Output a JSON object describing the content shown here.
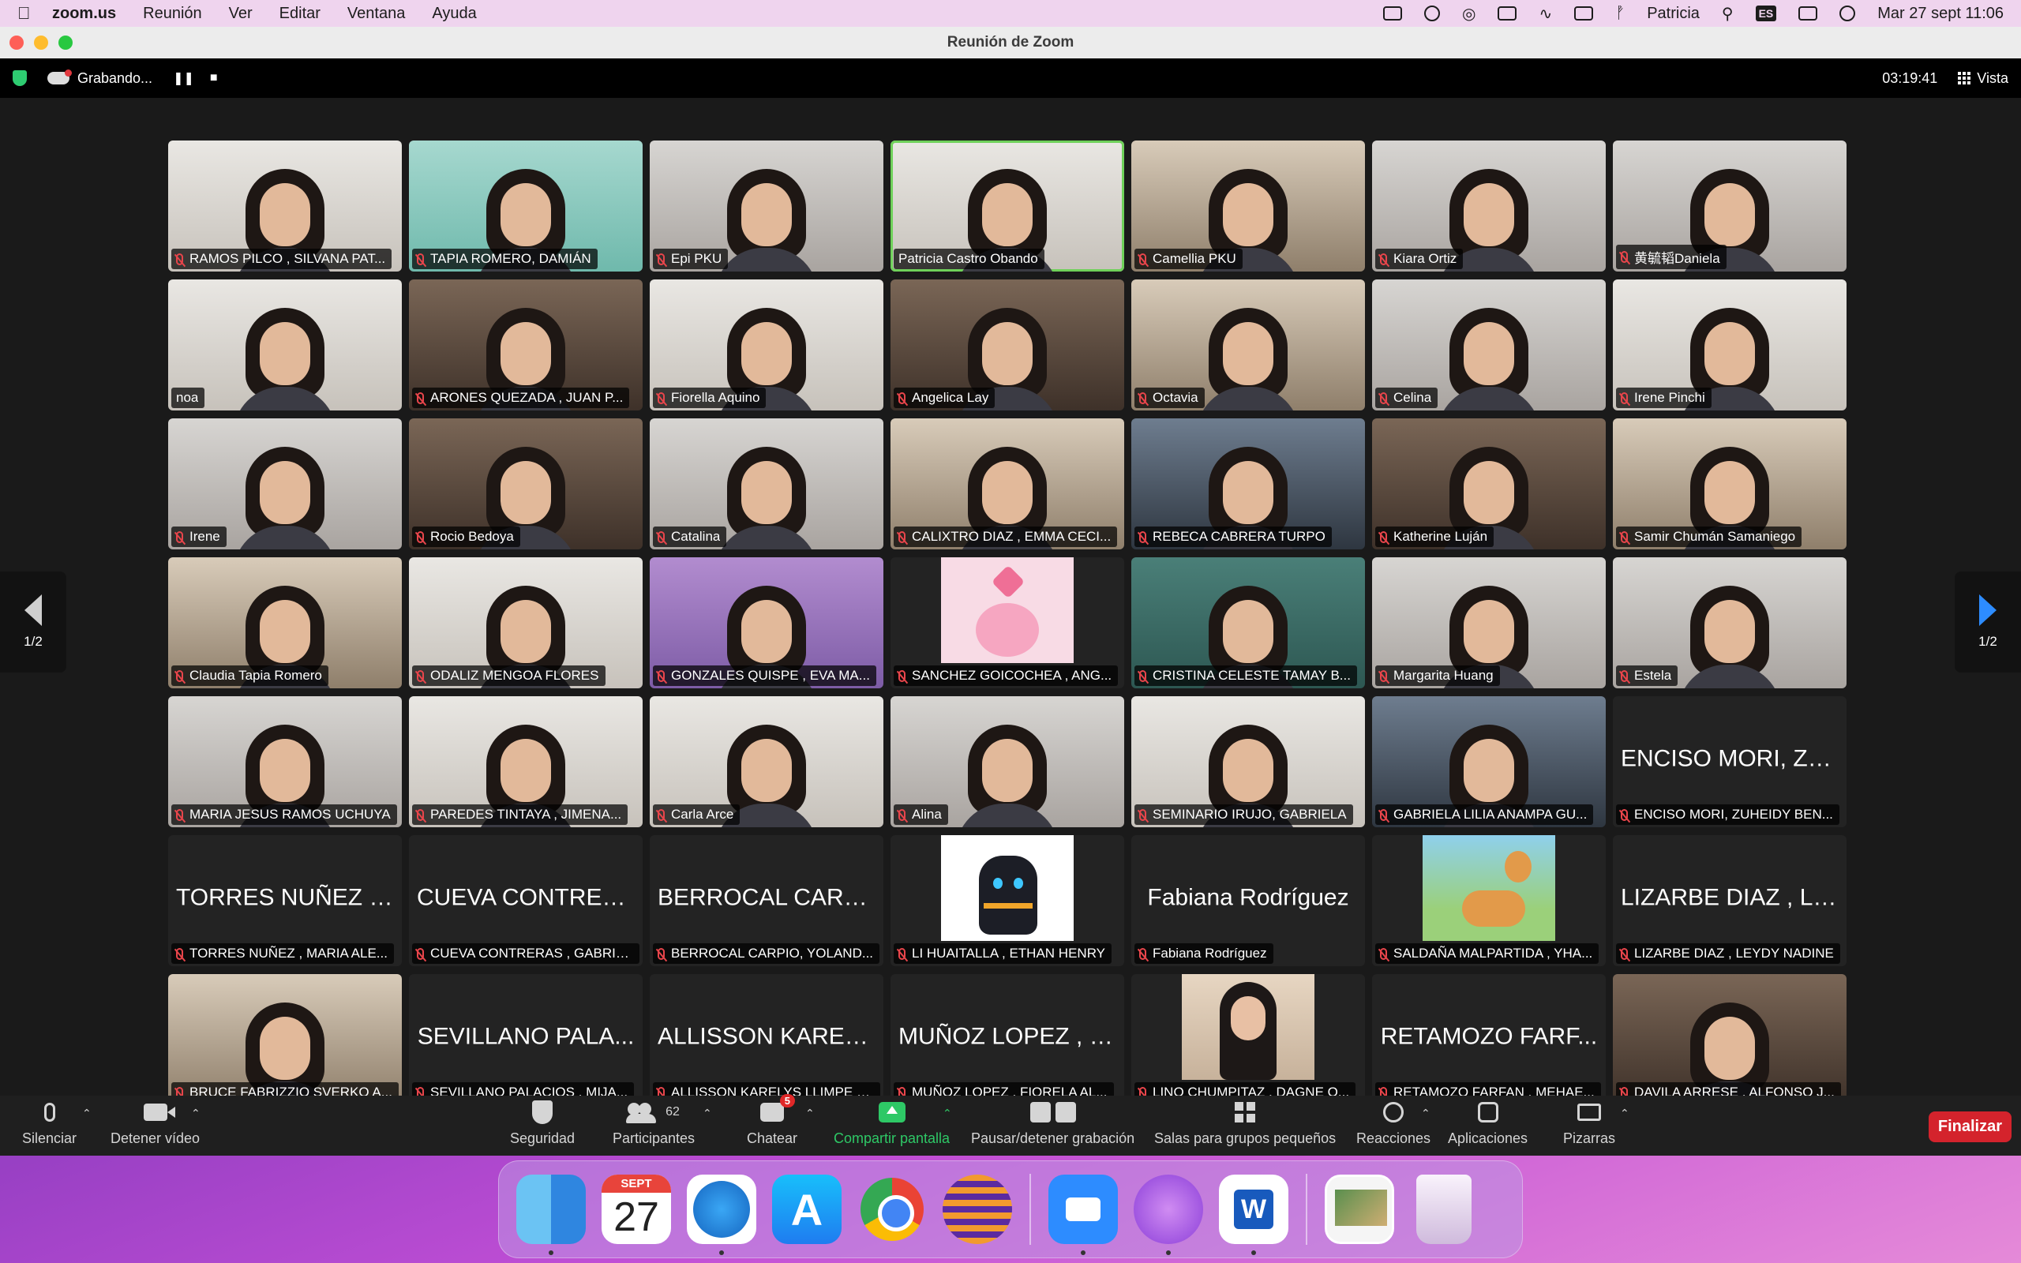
{
  "menubar": {
    "app_name": "zoom.us",
    "menus": [
      "Reunión",
      "Ver",
      "Editar",
      "Ventana",
      "Ayuda"
    ],
    "user": "Patricia",
    "lang_badge": "ES",
    "datetime": "Mar 27 sept  11:06"
  },
  "window": {
    "title": "Reunión de Zoom"
  },
  "topbar": {
    "recording_label": "Grabando...",
    "timer": "03:19:41",
    "view_label": "Vista"
  },
  "pager": {
    "left_label": "1/2",
    "right_label": "1/2"
  },
  "tiles": [
    {
      "label": "RAMOS PILCO , SILVANA PAT...",
      "muted": true,
      "kind": "video",
      "style": "v1"
    },
    {
      "label": "TAPIA ROMERO, DAMIÁN",
      "muted": true,
      "kind": "video",
      "style": "v2"
    },
    {
      "label": "Epi PKU",
      "muted": true,
      "kind": "video",
      "style": "v5"
    },
    {
      "label": "Patricia Castro Obando",
      "muted": false,
      "kind": "video",
      "style": "v1",
      "active": true
    },
    {
      "label": "Camellia PKU",
      "muted": true,
      "kind": "video",
      "style": "v3"
    },
    {
      "label": "Kiara Ortiz",
      "muted": true,
      "kind": "video",
      "style": "v5"
    },
    {
      "label": "黄毓韬Daniela",
      "muted": true,
      "kind": "video",
      "style": "v5"
    },
    {
      "label": "noa",
      "muted": false,
      "kind": "video",
      "style": "v1"
    },
    {
      "label": "ARONES QUEZADA , JUAN P...",
      "muted": true,
      "kind": "video",
      "style": "v4"
    },
    {
      "label": "Fiorella Aquino",
      "muted": true,
      "kind": "video",
      "style": "v1"
    },
    {
      "label": "Angelica Lay",
      "muted": true,
      "kind": "video",
      "style": "v4"
    },
    {
      "label": "Octavia",
      "muted": true,
      "kind": "video",
      "style": "v3"
    },
    {
      "label": "Celina",
      "muted": true,
      "kind": "video",
      "style": "v5"
    },
    {
      "label": "Irene Pinchi",
      "muted": true,
      "kind": "video",
      "style": "v1"
    },
    {
      "label": "Irene",
      "muted": true,
      "kind": "video",
      "style": "v5"
    },
    {
      "label": "Rocio Bedoya",
      "muted": true,
      "kind": "video",
      "style": "v4"
    },
    {
      "label": "Catalina",
      "muted": true,
      "kind": "video",
      "style": "v5"
    },
    {
      "label": "CALIXTRO DIAZ , EMMA CECI...",
      "muted": true,
      "kind": "video",
      "style": "v3"
    },
    {
      "label": "REBECA CABRERA TURPO",
      "muted": true,
      "kind": "video",
      "style": "v8"
    },
    {
      "label": "Katherine Luján",
      "muted": true,
      "kind": "video",
      "style": "v4"
    },
    {
      "label": "Samir Chumán Samaniego",
      "muted": true,
      "kind": "video",
      "style": "v3"
    },
    {
      "label": "Claudia Tapia Romero",
      "muted": true,
      "kind": "video",
      "style": "v3"
    },
    {
      "label": "ODALIZ MENGOA FLORES",
      "muted": true,
      "kind": "video",
      "style": "v1"
    },
    {
      "label": "GONZALES QUISPE , EVA MA...",
      "muted": true,
      "kind": "video",
      "style": "v7"
    },
    {
      "label": "SANCHEZ GOICOCHEA , ANG...",
      "muted": true,
      "kind": "avatar",
      "avatar": "kirby"
    },
    {
      "label": "CRISTINA CELESTE TAMAY B...",
      "muted": true,
      "kind": "video",
      "style": "v6"
    },
    {
      "label": "Margarita Huang",
      "muted": true,
      "kind": "video",
      "style": "v5"
    },
    {
      "label": "Estela",
      "muted": true,
      "kind": "video",
      "style": "v5"
    },
    {
      "label": "MARIA JESUS RAMOS UCHUYA",
      "muted": true,
      "kind": "video",
      "style": "v5"
    },
    {
      "label": "PAREDES TINTAYA , JIMENA...",
      "muted": true,
      "kind": "video",
      "style": "v1"
    },
    {
      "label": "Carla Arce",
      "muted": true,
      "kind": "video",
      "style": "v1"
    },
    {
      "label": "Alina",
      "muted": true,
      "kind": "video",
      "style": "v5"
    },
    {
      "label": "SEMINARIO IRUJO, GABRIELA",
      "muted": true,
      "kind": "video",
      "style": "v1"
    },
    {
      "label": "GABRIELA LILIA ANAMPA GU...",
      "muted": true,
      "kind": "video",
      "style": "v8"
    },
    {
      "label": "ENCISO MORI, ZUHEIDY BEN...",
      "muted": true,
      "kind": "name",
      "display": "ENCISO MORI, ZU..."
    },
    {
      "label": "TORRES NUÑEZ , MARIA ALE...",
      "muted": true,
      "kind": "name",
      "display": "TORRES NUÑEZ ,..."
    },
    {
      "label": "CUEVA CONTRERAS , GABRIE...",
      "muted": true,
      "kind": "name",
      "display": "CUEVA CONTRER..."
    },
    {
      "label": "BERROCAL CARPIO, YOLAND...",
      "muted": true,
      "kind": "name",
      "display": "BERROCAL CARPI..."
    },
    {
      "label": "LI HUAITALLA , ETHAN HENRY",
      "muted": true,
      "kind": "avatar",
      "avatar": "cat"
    },
    {
      "label": "Fabiana Rodríguez",
      "muted": true,
      "kind": "name",
      "display": "Fabiana Rodríguez"
    },
    {
      "label": "SALDAÑA MALPARTIDA , YHA...",
      "muted": true,
      "kind": "avatar",
      "avatar": "cartoon"
    },
    {
      "label": "LIZARBE DIAZ , LEYDY NADINE",
      "muted": true,
      "kind": "name",
      "display": "LIZARBE DIAZ , LE..."
    },
    {
      "label": "BRUCE FABRIZZIO SVERKO A...",
      "muted": true,
      "kind": "video",
      "style": "v3"
    },
    {
      "label": "SEVILLANO PALACIOS , MIJA...",
      "muted": true,
      "kind": "name",
      "display": "SEVILLANO PALA..."
    },
    {
      "label": "ALLISSON KARELYS LLIMPE E...",
      "muted": true,
      "kind": "name",
      "display": "ALLISSON KARELY..."
    },
    {
      "label": "MUÑOZ LOPEZ , FIORELA AL...",
      "muted": true,
      "kind": "name",
      "display": "MUÑOZ LOPEZ , F..."
    },
    {
      "label": "LINO CHUMPITAZ , DAGNE O...",
      "muted": true,
      "kind": "avatar",
      "avatar": "photo"
    },
    {
      "label": "RETAMOZO FARFAN , MEHAE...",
      "muted": true,
      "kind": "name",
      "display": "RETAMOZO FARF..."
    },
    {
      "label": "DAVILA ARRESE , ALFONSO J...",
      "muted": true,
      "kind": "video",
      "style": "v4"
    }
  ],
  "toolbar": {
    "mute": "Silenciar",
    "video": "Detener vídeo",
    "security": "Seguridad",
    "participants": "Participantes",
    "participants_count": "62",
    "chat": "Chatear",
    "chat_badge": "5",
    "share": "Compartir pantalla",
    "recording": "Pausar/detener grabación",
    "rooms": "Salas para grupos pequeños",
    "reactions": "Reacciones",
    "apps": "Aplicaciones",
    "whiteboards": "Pizarras",
    "end": "Finalizar"
  },
  "dock": {
    "calendar_month": "SEPT",
    "calendar_day": "27",
    "appstore_glyph": "A",
    "word_glyph": "W"
  },
  "colors": {
    "accent_green": "#2ec866",
    "end_red": "#d4232c",
    "mute_red": "#e8454b",
    "zoom_blue": "#2d8cff"
  }
}
